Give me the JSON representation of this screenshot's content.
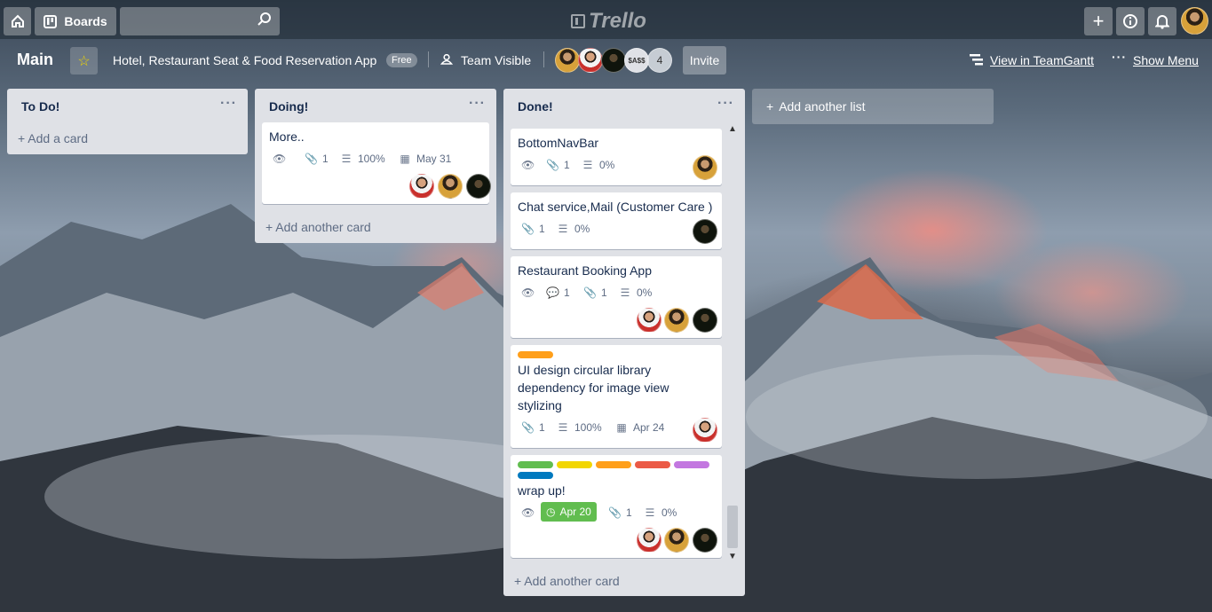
{
  "topbar": {
    "home_icon": "home-icon",
    "boards_label": "Boards",
    "search_placeholder": "",
    "logo_text": "Trello",
    "add_icon": "plus-icon",
    "info_icon": "info-icon",
    "bell_icon": "bell-icon"
  },
  "board": {
    "title": "Main",
    "name": "Hotel, Restaurant Seat & Food Reservation App",
    "plan_badge": "Free",
    "visibility": "Team Visible",
    "members_more": "4",
    "member_text_avatar": "$A$$",
    "invite_label": "Invite",
    "teamgantt_label": "View in TeamGantt",
    "show_menu_label": "Show Menu"
  },
  "lists": [
    {
      "title": "To Do!",
      "add_label": "Add a card"
    },
    {
      "title": "Doing!",
      "add_label": "Add another card",
      "cards": [
        {
          "title": "More..",
          "attachments": "1",
          "checklist": "100%",
          "due": "May 31"
        }
      ]
    },
    {
      "title": "Done!",
      "add_label": "Add another card",
      "cards": [
        {
          "title": "BottomNavBar",
          "attachments": "1",
          "checklist": "0%"
        },
        {
          "title": "Chat service,Mail (Customer Care )",
          "attachments": "1",
          "checklist": "0%"
        },
        {
          "title": "Restaurant Booking App",
          "comments": "1",
          "attachments": "1",
          "checklist": "0%"
        },
        {
          "title_lines": [
            "UI design circular library",
            "dependency for image view",
            "stylizing"
          ],
          "attachments": "1",
          "checklist": "100%",
          "due": "Apr 24"
        },
        {
          "title": "wrap up!",
          "due": "Apr 20",
          "attachments": "1",
          "checklist": "0%"
        }
      ]
    }
  ],
  "add_list_label": "Add another list",
  "colors": {
    "label_green": "#61bd4f",
    "label_yellow": "#f2d600",
    "label_orange": "#ff9f1a",
    "label_red": "#eb5a46",
    "label_purple": "#c377e0",
    "label_blue": "#0079bf"
  }
}
